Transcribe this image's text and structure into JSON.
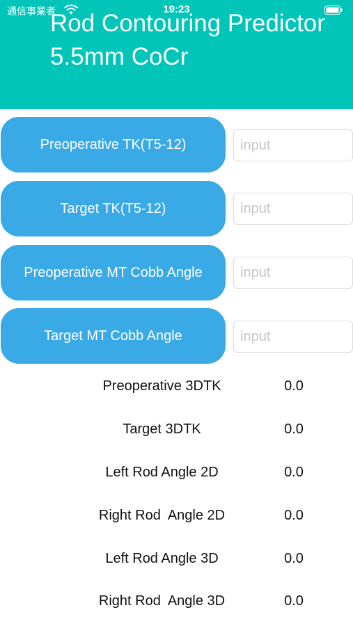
{
  "status_bar": {
    "carrier": "通信事業者",
    "time": "19:23"
  },
  "header": {
    "title": "Rod Contouring Predictor 5.5mm CoCr",
    "background_color": "#00c5b8"
  },
  "inputs": [
    {
      "label": "Preoperative TK(T5-12)",
      "placeholder": "input",
      "value": ""
    },
    {
      "label": "Target TK(T5-12)",
      "placeholder": "input",
      "value": ""
    },
    {
      "label": "Preoperative MT Cobb Angle",
      "placeholder": "input",
      "value": ""
    },
    {
      "label": "Target MT Cobb Angle",
      "placeholder": "input",
      "value": ""
    }
  ],
  "results": [
    {
      "label": "Preoperative 3DTK",
      "value": "0.0"
    },
    {
      "label": "Target 3DTK",
      "value": "0.0"
    },
    {
      "label": "Left Rod Angle 2D",
      "value": "0.0"
    },
    {
      "label": "Right Rod  Angle 2D",
      "value": "0.0"
    },
    {
      "label": "Left Rod Angle 3D",
      "value": "0.0"
    },
    {
      "label": "Right Rod  Angle 3D",
      "value": "0.0"
    }
  ],
  "colors": {
    "button": "#3aaae6",
    "button_text": "#ffffff"
  }
}
